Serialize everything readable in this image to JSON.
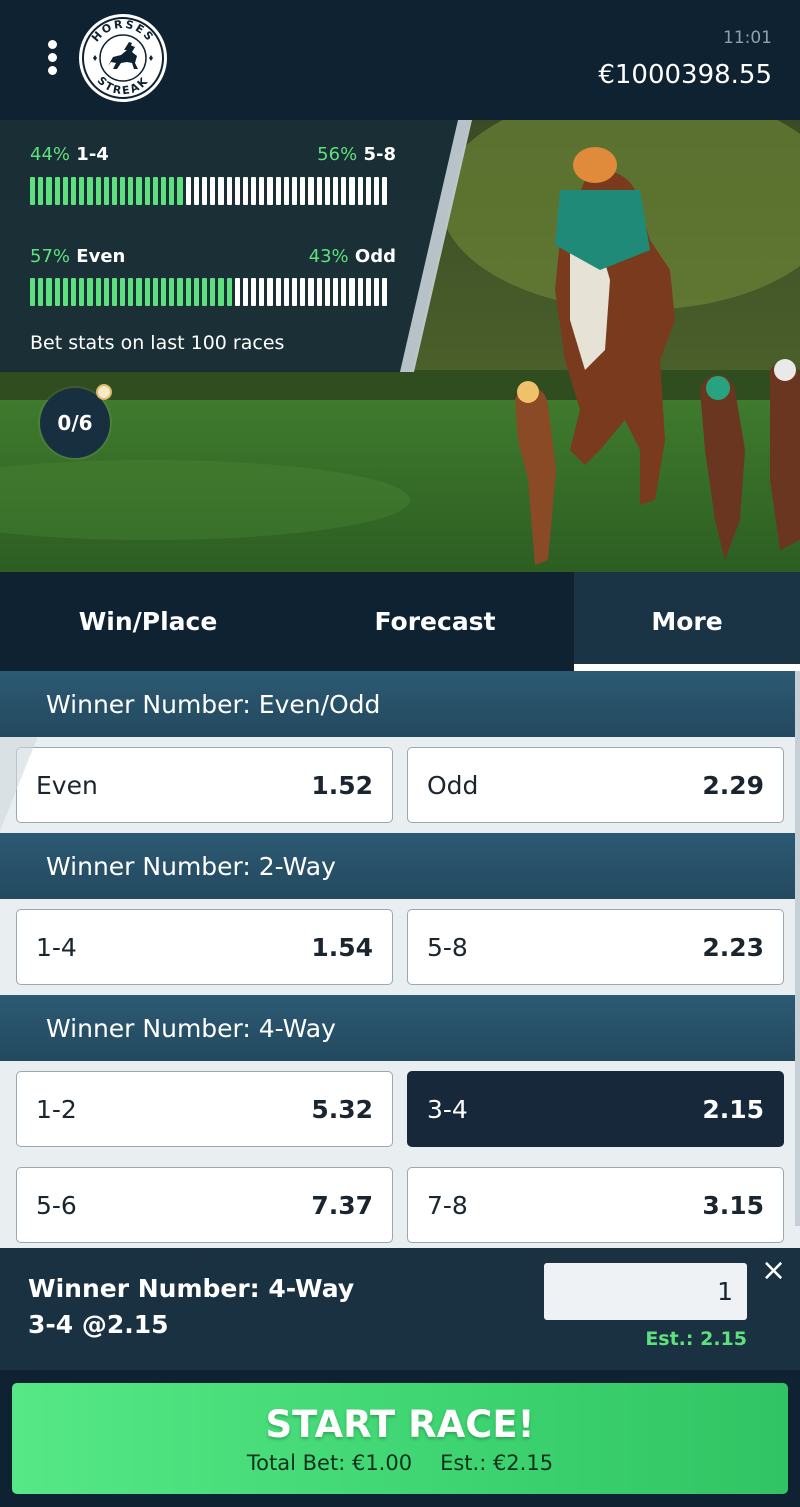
{
  "header": {
    "time": "11:01",
    "balance": "€1000398.55",
    "logo_top_text": "HORSES",
    "logo_bottom_text": "STREAK"
  },
  "stats": {
    "range": {
      "left_pct": "44%",
      "left_label": "1-4",
      "right_pct": "56%",
      "right_label": "5-8",
      "left_fraction": 0.44
    },
    "parity": {
      "left_pct": "57%",
      "left_label": "Even",
      "right_pct": "43%",
      "right_label": "Odd",
      "left_fraction": 0.57
    },
    "caption": "Bet stats on last 100 races"
  },
  "counter": {
    "value": "0/6"
  },
  "tabs": [
    {
      "label": "Win/Place",
      "active": false
    },
    {
      "label": "Forecast",
      "active": false
    },
    {
      "label": "More",
      "active": true
    }
  ],
  "markets": [
    {
      "title": "Winner Number: Even/Odd",
      "options": [
        {
          "name": "Even",
          "odds": "1.52"
        },
        {
          "name": "Odd",
          "odds": "2.29"
        }
      ]
    },
    {
      "title": "Winner Number: 2-Way",
      "options": [
        {
          "name": "1-4",
          "odds": "1.54"
        },
        {
          "name": "5-8",
          "odds": "2.23"
        }
      ]
    },
    {
      "title": "Winner Number: 4-Way",
      "options": [
        {
          "name": "1-2",
          "odds": "5.32"
        },
        {
          "name": "3-4",
          "odds": "2.15",
          "selected": true
        },
        {
          "name": "5-6",
          "odds": "7.37"
        },
        {
          "name": "7-8",
          "odds": "3.15"
        }
      ]
    }
  ],
  "betslip": {
    "market": "Winner Number: 4-Way",
    "selection": "3-4  @2.15",
    "stake": "1",
    "estimate": "Est.: 2.15",
    "close_symbol": "×"
  },
  "start": {
    "title": "START RACE!",
    "total_bet": "Total Bet: €1.00",
    "estimate": "Est.: €2.15"
  },
  "colors": {
    "background": "#0f2231",
    "accent_green": "#5fe07e",
    "section_header": "#2c5a73",
    "selected_option": "#16283a",
    "start_button": "#4bdf7c"
  }
}
